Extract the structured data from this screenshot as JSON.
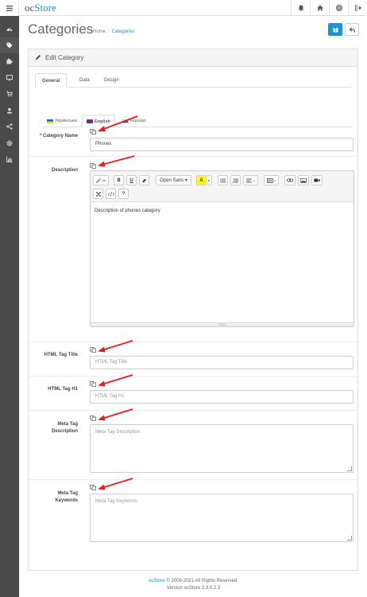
{
  "header": {
    "logo_prefix": "oc",
    "logo_brand": "Store"
  },
  "page": {
    "title": "Categories",
    "breadcrumb": [
      "Home",
      "Categories"
    ],
    "panel_title": "Edit Category"
  },
  "tabs": [
    "General",
    "Data",
    "Design"
  ],
  "languages": [
    "Українська",
    "English",
    "Russian"
  ],
  "form": {
    "category_name_label": "Category Name",
    "category_name_value": "Phones",
    "description_label": "Description",
    "description_text": "Description of phones category",
    "editor_font": "Open Sans",
    "html_title_label": "HTML Tag Title",
    "html_title_placeholder": "HTML Tag Title",
    "html_h1_label": "HTML Tag H1",
    "html_h1_placeholder": "HTML Tag H1",
    "meta_desc_label_1": "Meta Tag",
    "meta_desc_label_2": "Description",
    "meta_desc_placeholder": "Meta Tag Description",
    "meta_kw_label_1": "Meta Tag",
    "meta_kw_label_2": "Keywords",
    "meta_kw_placeholder": "Meta Tag Keywords"
  },
  "footer": {
    "brand": "ocStore",
    "copyright": "© 2009-2021 All Rights Reserved.",
    "version": "Version ocStore 2.3.0.2.3"
  },
  "colors": {
    "accent": "#1e91cf",
    "sidebar": "#4a4a4a",
    "arrow": "#e02020"
  },
  "icons": {
    "menu": "bars-icon",
    "topbar": [
      "bell-icon",
      "home-icon",
      "life-ring-icon",
      "sign-out-icon"
    ],
    "sidebar": [
      "dashboard-icon",
      "tag-icon",
      "puzzle-icon",
      "desktop-icon",
      "cart-icon",
      "user-icon",
      "share-icon",
      "cog-icon",
      "chart-icon"
    ]
  }
}
